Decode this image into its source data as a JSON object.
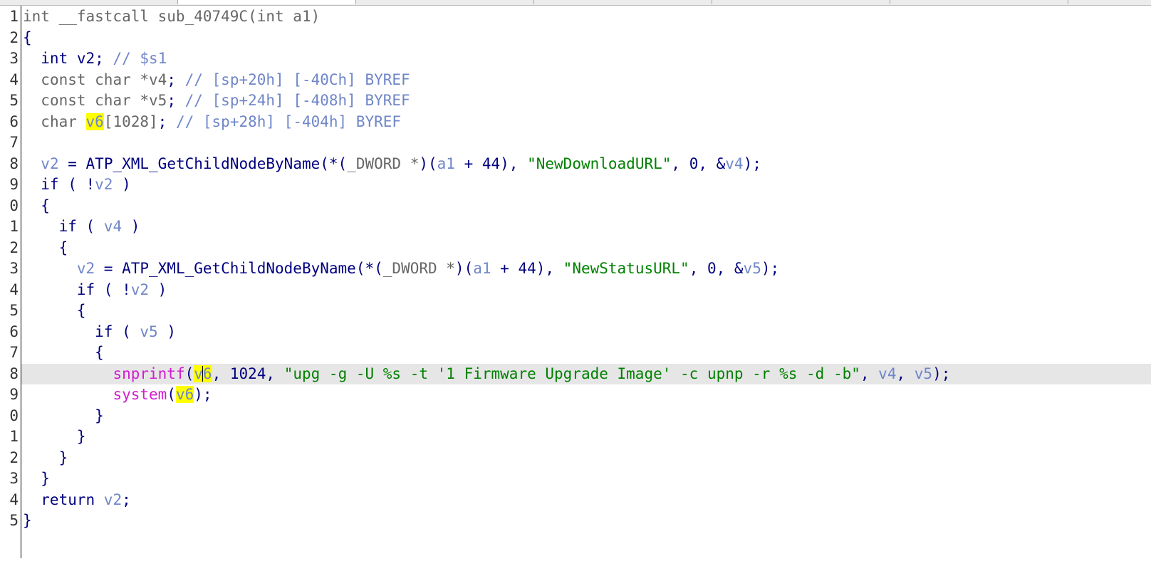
{
  "code_lines": [
    {
      "n": "1",
      "current": false,
      "tokens": [
        [
          "type",
          "int __fastcall sub_40749C("
        ],
        [
          "type",
          "int a1"
        ],
        [
          "type",
          ")"
        ]
      ]
    },
    {
      "n": "2",
      "current": false,
      "tokens": [
        [
          "plain",
          "{"
        ]
      ]
    },
    {
      "n": "3",
      "current": false,
      "tokens": [
        [
          "plain",
          "  int v2; "
        ],
        [
          "cmt",
          "// $s1"
        ]
      ]
    },
    {
      "n": "4",
      "current": false,
      "tokens": [
        [
          "plain",
          "  "
        ],
        [
          "type",
          "const char *v4"
        ],
        [
          "plain",
          "; "
        ],
        [
          "cmt",
          "// [sp+20h] [-40Ch] BYREF"
        ]
      ]
    },
    {
      "n": "5",
      "current": false,
      "tokens": [
        [
          "plain",
          "  "
        ],
        [
          "type",
          "const char *v5"
        ],
        [
          "plain",
          "; "
        ],
        [
          "cmt",
          "// [sp+24h] [-408h] BYREF"
        ]
      ]
    },
    {
      "n": "6",
      "current": false,
      "tokens": [
        [
          "plain",
          "  "
        ],
        [
          "type",
          "char "
        ],
        [
          "hl",
          "v6"
        ],
        [
          "type",
          "[1028]"
        ],
        [
          "plain",
          "; "
        ],
        [
          "cmt",
          "// [sp+28h] [-404h] BYREF"
        ]
      ]
    },
    {
      "n": "7",
      "current": false,
      "tokens": []
    },
    {
      "n": "8",
      "current": false,
      "tokens": [
        [
          "plain",
          "  "
        ],
        [
          "var",
          "v2"
        ],
        [
          "plain",
          " = "
        ],
        [
          "func",
          "ATP_XML_GetChildNodeByName"
        ],
        [
          "plain",
          "(*("
        ],
        [
          "type",
          "_DWORD *"
        ],
        [
          "plain",
          ")("
        ],
        [
          "var",
          "a1"
        ],
        [
          "plain",
          " + 44), "
        ],
        [
          "str",
          "\"NewDownloadURL\""
        ],
        [
          "plain",
          ", 0, &"
        ],
        [
          "var",
          "v4"
        ],
        [
          "plain",
          ");"
        ]
      ]
    },
    {
      "n": "9",
      "current": false,
      "tokens": [
        [
          "plain",
          "  if ( !"
        ],
        [
          "var",
          "v2"
        ],
        [
          "plain",
          " )"
        ]
      ]
    },
    {
      "n": "0",
      "current": false,
      "tokens": [
        [
          "plain",
          "  {"
        ]
      ]
    },
    {
      "n": "1",
      "current": false,
      "tokens": [
        [
          "plain",
          "    if ( "
        ],
        [
          "var",
          "v4"
        ],
        [
          "plain",
          " )"
        ]
      ]
    },
    {
      "n": "2",
      "current": false,
      "tokens": [
        [
          "plain",
          "    {"
        ]
      ]
    },
    {
      "n": "3",
      "current": false,
      "tokens": [
        [
          "plain",
          "      "
        ],
        [
          "var",
          "v2"
        ],
        [
          "plain",
          " = "
        ],
        [
          "func",
          "ATP_XML_GetChildNodeByName"
        ],
        [
          "plain",
          "(*("
        ],
        [
          "type",
          "_DWORD *"
        ],
        [
          "plain",
          ")("
        ],
        [
          "var",
          "a1"
        ],
        [
          "plain",
          " + 44), "
        ],
        [
          "str",
          "\"NewStatusURL\""
        ],
        [
          "plain",
          ", 0, &"
        ],
        [
          "var",
          "v5"
        ],
        [
          "plain",
          ");"
        ]
      ]
    },
    {
      "n": "4",
      "current": false,
      "tokens": [
        [
          "plain",
          "      if ( !"
        ],
        [
          "var",
          "v2"
        ],
        [
          "plain",
          " )"
        ]
      ]
    },
    {
      "n": "5",
      "current": false,
      "tokens": [
        [
          "plain",
          "      {"
        ]
      ]
    },
    {
      "n": "6",
      "current": false,
      "tokens": [
        [
          "plain",
          "        if ( "
        ],
        [
          "var",
          "v5"
        ],
        [
          "plain",
          " )"
        ]
      ]
    },
    {
      "n": "7",
      "current": false,
      "tokens": [
        [
          "plain",
          "        {"
        ]
      ]
    },
    {
      "n": "8",
      "current": true,
      "tokens": [
        [
          "plain",
          "          "
        ],
        [
          "imp",
          "snprintf"
        ],
        [
          "plain",
          "("
        ],
        [
          "hl",
          "v"
        ],
        [
          "caret",
          ""
        ],
        [
          "hl",
          "6"
        ],
        [
          "plain",
          ", 1024, "
        ],
        [
          "str",
          "\"upg -g -U %s -t '1 Firmware Upgrade Image' -c upnp -r %s -d -b\""
        ],
        [
          "plain",
          ", "
        ],
        [
          "var",
          "v4"
        ],
        [
          "plain",
          ", "
        ],
        [
          "var",
          "v5"
        ],
        [
          "plain",
          ");"
        ]
      ]
    },
    {
      "n": "9",
      "current": false,
      "tokens": [
        [
          "plain",
          "          "
        ],
        [
          "imp",
          "system"
        ],
        [
          "plain",
          "("
        ],
        [
          "hl",
          "v6"
        ],
        [
          "plain",
          ");"
        ]
      ]
    },
    {
      "n": "0",
      "current": false,
      "tokens": [
        [
          "plain",
          "        }"
        ]
      ]
    },
    {
      "n": "1",
      "current": false,
      "tokens": [
        [
          "plain",
          "      }"
        ]
      ]
    },
    {
      "n": "2",
      "current": false,
      "tokens": [
        [
          "plain",
          "    }"
        ]
      ]
    },
    {
      "n": "3",
      "current": false,
      "tokens": [
        [
          "plain",
          "  }"
        ]
      ]
    },
    {
      "n": "4",
      "current": false,
      "tokens": [
        [
          "plain",
          "  return "
        ],
        [
          "var",
          "v2"
        ],
        [
          "plain",
          ";"
        ]
      ]
    },
    {
      "n": "5",
      "current": false,
      "tokens": [
        [
          "plain",
          "}"
        ]
      ]
    }
  ],
  "colors": {
    "plain": "#000080",
    "type": "#666666",
    "var": "#6f86c8",
    "comment": "#6f86c8",
    "string": "#008000",
    "import": "#d01cd0",
    "highlight": "#ffff00",
    "current_line": "#e6e6e6"
  }
}
